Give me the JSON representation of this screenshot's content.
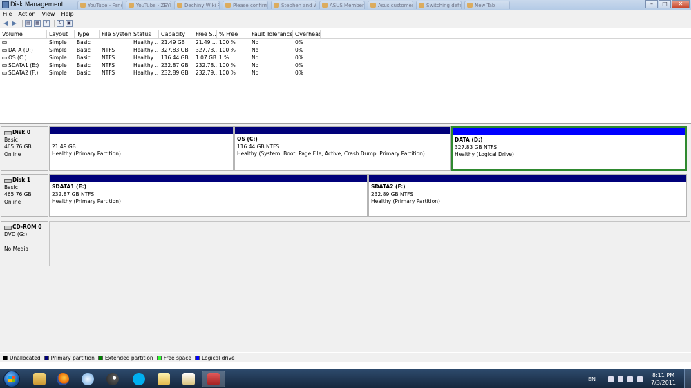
{
  "window": {
    "title": "Disk Management"
  },
  "background_tabs": [
    "YouTube - Fanc...",
    "YouTube - ZEYNE...",
    "Dechiny Wiki Fan...",
    "Please confirm yo...",
    "Stephen and Wom...",
    "ASUS Member Inc...",
    "Asus customer ser...",
    "Switching default ...",
    "New Tab"
  ],
  "menu": [
    "File",
    "Action",
    "View",
    "Help"
  ],
  "toolbar_icons": [
    "back-arrow-icon",
    "forward-arrow-icon",
    "console-tree-icon",
    "properties-icon",
    "help-icon",
    "refresh-icon",
    "rescan-disks-icon"
  ],
  "volume_list": {
    "columns": [
      "Volume",
      "Layout",
      "Type",
      "File System",
      "Status",
      "Capacity",
      "Free S...",
      "% Free",
      "Fault Tolerance",
      "Overhead"
    ],
    "rows": [
      [
        "",
        "Simple",
        "Basic",
        "",
        "Healthy ...",
        "21.49 GB",
        "21.49 ...",
        "100 %",
        "No",
        "0%"
      ],
      [
        "DATA (D:)",
        "Simple",
        "Basic",
        "NTFS",
        "Healthy ...",
        "327.83 GB",
        "327.73...",
        "100 %",
        "No",
        "0%"
      ],
      [
        "OS (C:)",
        "Simple",
        "Basic",
        "NTFS",
        "Healthy ...",
        "116.44 GB",
        "1.07 GB",
        "1 %",
        "No",
        "0%"
      ],
      [
        "SDATA1 (E:)",
        "Simple",
        "Basic",
        "NTFS",
        "Healthy ...",
        "232.87 GB",
        "232.78...",
        "100 %",
        "No",
        "0%"
      ],
      [
        "SDATA2 (F:)",
        "Simple",
        "Basic",
        "NTFS",
        "Healthy ...",
        "232.89 GB",
        "232.79...",
        "100 %",
        "No",
        "0%"
      ]
    ]
  },
  "disks": {
    "disk0": {
      "name": "Disk 0",
      "type": "Basic",
      "size": "465.76 GB",
      "status": "Online",
      "partitions": [
        {
          "name": "",
          "size": "21.49 GB",
          "status": "Healthy (Primary Partition)"
        },
        {
          "name": "OS  (C:)",
          "size": "116.44 GB NTFS",
          "status": "Healthy (System, Boot, Page File, Active, Crash Dump, Primary Partition)"
        },
        {
          "name": "DATA  (D:)",
          "size": "327.83 GB NTFS",
          "status": "Healthy (Logical Drive)"
        }
      ]
    },
    "disk1": {
      "name": "Disk 1",
      "type": "Basic",
      "size": "465.76 GB",
      "status": "Online",
      "partitions": [
        {
          "name": "SDATA1  (E:)",
          "size": "232.87 GB NTFS",
          "status": "Healthy (Primary Partition)"
        },
        {
          "name": "SDATA2  (F:)",
          "size": "232.89 GB NTFS",
          "status": "Healthy (Primary Partition)"
        }
      ]
    },
    "cdrom0": {
      "name": "CD-ROM 0",
      "type": "DVD (G:)",
      "status": "No Media"
    }
  },
  "legend": [
    {
      "label": "Unallocated",
      "color": "#000000"
    },
    {
      "label": "Primary partition",
      "color": "#00007a"
    },
    {
      "label": "Extended partition",
      "color": "#008000"
    },
    {
      "label": "Free space",
      "color": "#33ff33"
    },
    {
      "label": "Logical drive",
      "color": "#0000ff"
    }
  ],
  "taskbar": {
    "apps": [
      "windows-explorer-icon",
      "firefox-icon",
      "itunes-icon",
      "steam-icon",
      "skype-icon",
      "folder-icon",
      "folder-documents-icon",
      "disk-management-icon"
    ],
    "language": "EN",
    "time": "8:11 PM",
    "date": "7/3/2011"
  }
}
